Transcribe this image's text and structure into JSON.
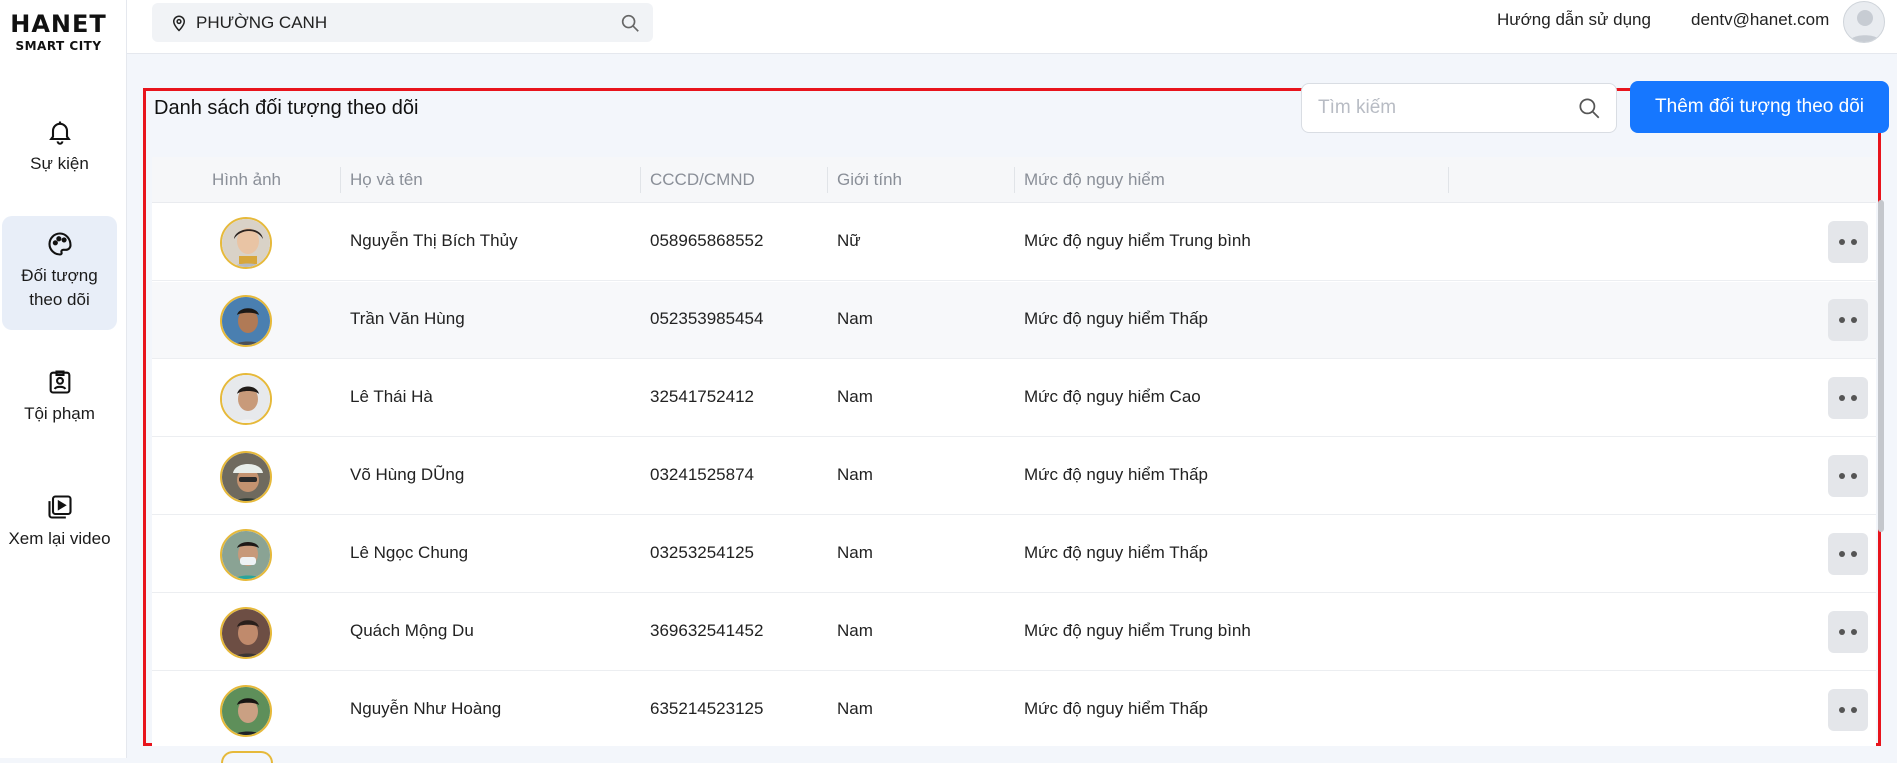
{
  "app": {
    "logo_brand": "HANET",
    "logo_sub": "SMART CITY"
  },
  "sidebar": {
    "items": [
      {
        "label": "Sự kiện",
        "icon": "bell-icon"
      },
      {
        "label": "Đối tượng theo dõi",
        "icon": "palette-icon",
        "active": true
      },
      {
        "label": "Tội phạm",
        "icon": "id-badge-icon"
      },
      {
        "label": "Xem lại video",
        "icon": "video-library-icon"
      }
    ]
  },
  "topbar": {
    "location": "PHƯỜNG CANH",
    "help": "Hướng dẫn sử dụng",
    "email": "dentv@hanet.com"
  },
  "panel": {
    "title": "Danh sách đối tượng theo dõi",
    "search_placeholder": "Tìm kiếm",
    "add_button": "Thêm đối tượng theo dõi"
  },
  "table": {
    "columns": [
      "Hình ảnh",
      "Họ và tên",
      "CCCD/CMND",
      "Giới tính",
      "Mức độ nguy hiểm"
    ],
    "rows": [
      {
        "name": "Nguyễn Thị Bích Thủy",
        "id": "058965868552",
        "gender": "Nữ",
        "risk": "Mức độ nguy hiểm Trung bình"
      },
      {
        "name": "Trần Văn Hùng",
        "id": "052353985454",
        "gender": "Nam",
        "risk": "Mức độ nguy hiểm Thấp"
      },
      {
        "name": "Lê Thái Hà",
        "id": "32541752412",
        "gender": "Nam",
        "risk": "Mức độ nguy hiểm Cao"
      },
      {
        "name": "Võ Hùng DŨng",
        "id": "03241525874",
        "gender": "Nam",
        "risk": "Mức độ nguy hiểm Thấp"
      },
      {
        "name": "Lê Ngọc Chung",
        "id": "03253254125",
        "gender": "Nam",
        "risk": "Mức độ nguy hiểm Thấp"
      },
      {
        "name": "Quách Mộng Du",
        "id": "369632541452",
        "gender": "Nam",
        "risk": "Mức độ nguy hiểm Trung bình"
      },
      {
        "name": "Nguyễn Như Hoàng",
        "id": "635214523125",
        "gender": "Nam",
        "risk": "Mức độ nguy hiểm Thấp"
      }
    ]
  },
  "colors": {
    "accent": "#1677ff",
    "highlight_border": "#e8141c",
    "photo_ring": "#e6b93a"
  }
}
